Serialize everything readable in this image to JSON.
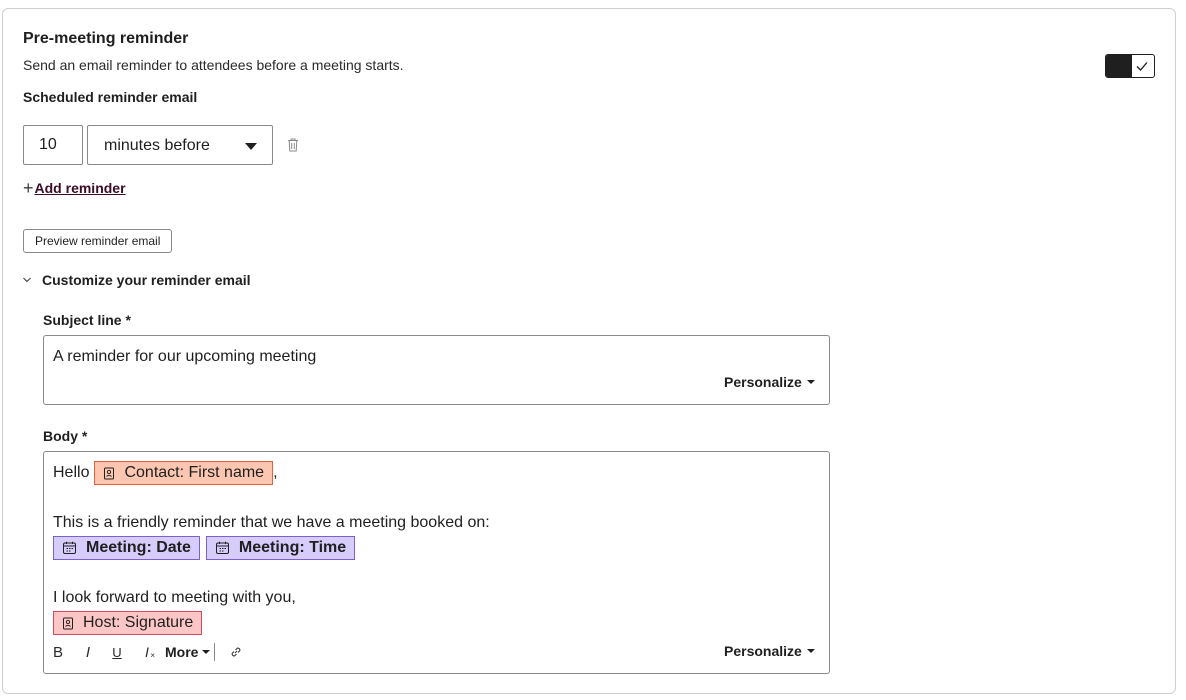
{
  "header": {
    "title": "Pre-meeting reminder",
    "subtitle": "Send an email reminder to attendees before a meeting starts.",
    "toggle_on": true
  },
  "schedule": {
    "label": "Scheduled reminder email",
    "amount": "10",
    "unit": "minutes before",
    "add_label": "Add reminder",
    "preview_label": "Preview reminder email"
  },
  "customize": {
    "label": "Customize your reminder email",
    "expanded": true
  },
  "subject": {
    "label": "Subject line *",
    "value": "A reminder for our upcoming meeting",
    "personalize": "Personalize"
  },
  "body": {
    "label": "Body *",
    "greeting": "Hello",
    "contact_token": "Contact: First name",
    "comma": ",",
    "line2": "This is a friendly reminder that we have a meeting booked on:",
    "date_token": "Meeting: Date",
    "time_token": "Meeting: Time",
    "line3": "I look forward to meeting with you,",
    "host_token": "Host: Signature",
    "personalize": "Personalize",
    "toolbar": {
      "bold": "B",
      "italic": "I",
      "underline": "U",
      "clear": "I",
      "more": "More"
    }
  },
  "colors": {
    "contact_token_bg": "#fcc6b0",
    "meeting_token_bg": "#d7cdfc",
    "host_token_bg": "#fcc6c6",
    "link": "#3b0a25"
  }
}
